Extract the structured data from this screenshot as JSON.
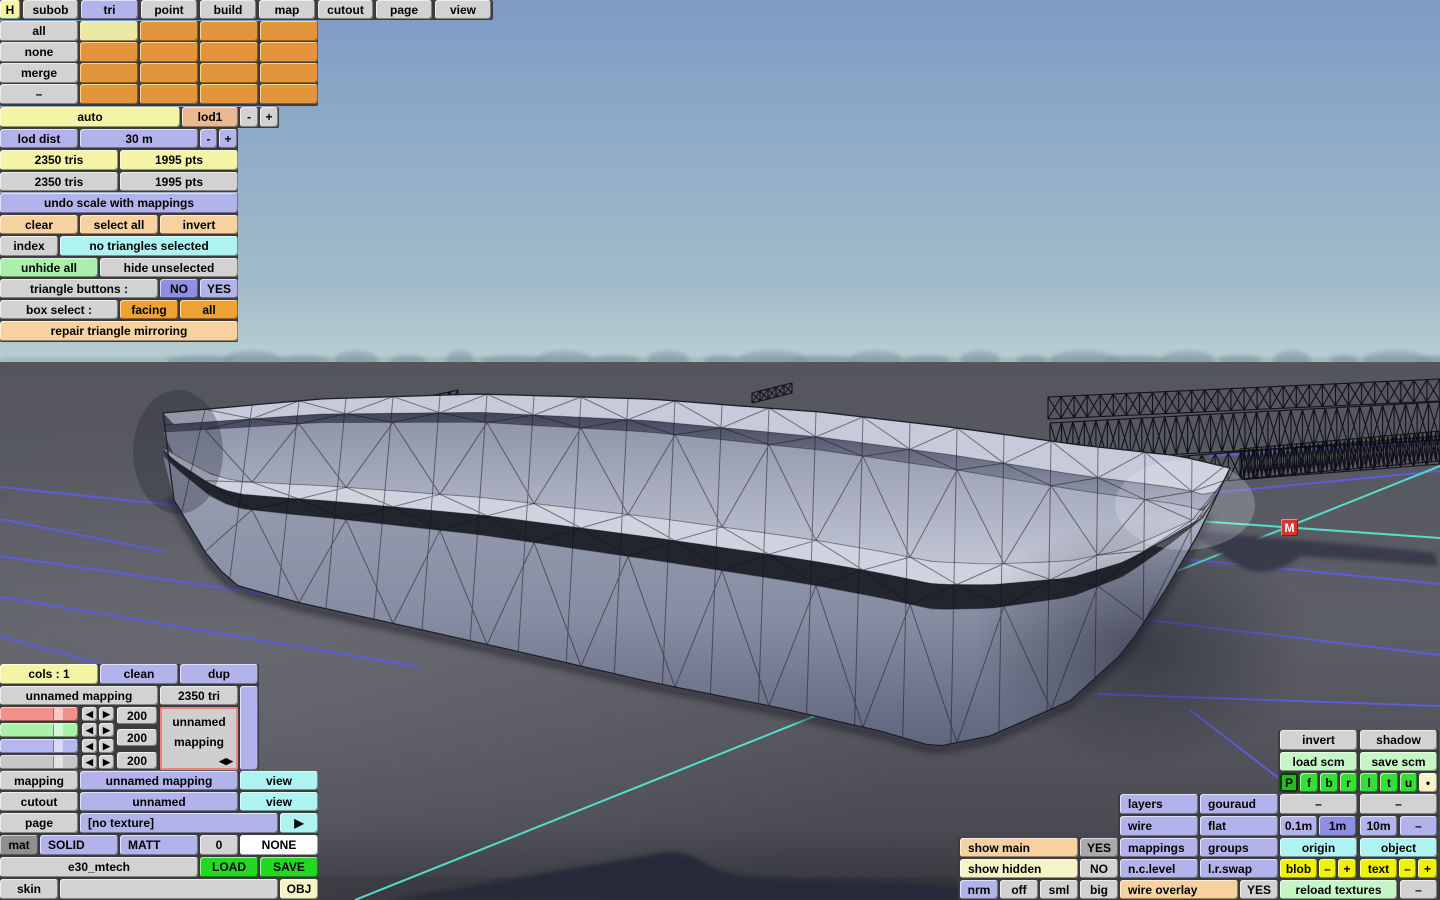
{
  "colors": {
    "accent_orange": "#e2953b",
    "accent_purple": "#b3b3ec",
    "accent_cyan": "#aef2f2",
    "accent_green": "#22d822",
    "accent_yellow": "#f0f00a",
    "marker_red": "#e03030",
    "sky_top": "#7d9cc5",
    "ground": "#57585f",
    "grid_blue": "#5c5cdd",
    "grid_cyan": "#4fe0cc"
  },
  "marker": {
    "label": "M"
  },
  "tabs": {
    "h": "H",
    "subob": "subob",
    "tri": "tri",
    "point": "point",
    "build": "build",
    "map": "map",
    "cutout": "cutout",
    "page": "page",
    "view": "view"
  },
  "selgrid": {
    "all": "all",
    "none": "none",
    "merge": "merge",
    "minus": "–"
  },
  "lod": {
    "auto": "auto",
    "lod1": "lod1",
    "minus": "-",
    "plus": "+",
    "dist_label": "lod dist",
    "dist_value": "30 m",
    "dist_minus": "-",
    "dist_plus": "+",
    "tris_current": "2350 tris",
    "pts_current": "1995 pts",
    "tris_total": "2350 tris",
    "pts_total": "1995 pts"
  },
  "selection": {
    "undo": "undo scale with mappings",
    "clear": "clear",
    "select_all": "select all",
    "invert": "invert",
    "index": "index",
    "status": "no triangles selected",
    "unhide_all": "unhide all",
    "hide_unselected": "hide unselected",
    "tb_label": "triangle buttons :",
    "tb_no": "NO",
    "tb_yes": "YES",
    "box_label": "box select :",
    "box_facing": "facing",
    "box_all": "all",
    "repair": "repair triangle mirroring"
  },
  "mapping": {
    "cols": "cols : 1",
    "clean": "clean",
    "dup": "dup",
    "name": "unnamed mapping",
    "tri_count": "2350 tri",
    "values": [
      "200",
      "200",
      "200"
    ],
    "preview_line1": "unnamed",
    "preview_line2": "mapping",
    "mapping_label": "mapping",
    "mapping_value": "unnamed mapping",
    "mapping_view": "view",
    "cutout_label": "cutout",
    "cutout_value": "unnamed",
    "cutout_view": "view",
    "page_label": "page",
    "page_value": "[no texture]",
    "page_next": "▶",
    "mat_label": "mat",
    "mat_solid": "SOLID",
    "mat_matt": "MATT",
    "mat_zero": "0",
    "mat_none": "NONE",
    "file_name": "e30_mtech",
    "load": "LOAD",
    "save": "SAVE",
    "skin": "skin",
    "obj": "OBJ"
  },
  "view": {
    "invert": "invert",
    "shadow": "shadow",
    "load_scm": "load scm",
    "save_scm": "save scm",
    "proj": [
      "P",
      "f",
      "b",
      "r",
      "l",
      "t",
      "u",
      "•"
    ],
    "layers": "layers",
    "gouraud": "gouraud",
    "dash1": "–",
    "dash2": "–",
    "wire": "wire",
    "flat": "flat",
    "g01": "0.1m",
    "g1": "1m",
    "g10": "10m",
    "gminus": "–",
    "show_main": "show main",
    "show_main_yes": "YES",
    "mappings": "mappings",
    "groups": "groups",
    "origin": "origin",
    "object": "object",
    "show_hidden": "show hidden",
    "show_hidden_no": "NO",
    "nclevel": "n.c.level",
    "lrswap": "l.r.swap",
    "blob": "blob",
    "blob_minus": "–",
    "blob_plus": "+",
    "text": "text",
    "text_minus": "–",
    "text_plus": "+",
    "nrm": "nrm",
    "off": "off",
    "sml": "sml",
    "big": "big",
    "wire_overlay": "wire overlay",
    "wire_overlay_yes": "YES",
    "reload": "reload textures",
    "reload_minus": "–"
  },
  "arrows": {
    "left": "◀",
    "right": "▶"
  }
}
